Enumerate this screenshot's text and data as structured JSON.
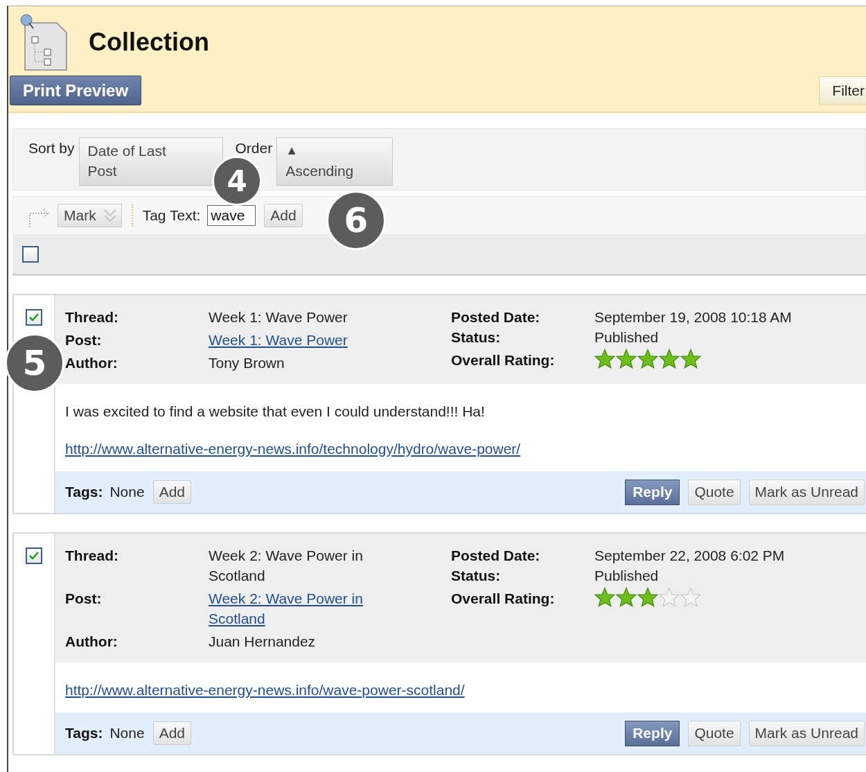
{
  "header": {
    "title": "Collection",
    "print_button": "Print Preview",
    "filter_button": "Filter"
  },
  "sort": {
    "label": "Sort by",
    "value": "Date of Last Post",
    "order_label": "Order",
    "order_arrow": "▲",
    "order_value": "Ascending"
  },
  "actions": {
    "mark": "Mark",
    "tag_label": "Tag Text:",
    "tag_value": "wave",
    "add": "Add"
  },
  "select_all": {
    "checked": false
  },
  "posts": [
    {
      "checked": true,
      "thread_label": "Thread:",
      "thread": "Week 1: Wave Power",
      "post_label": "Post:",
      "post": "Week 1: Wave Power",
      "author_label": "Author:",
      "author": "Tony Brown",
      "date_label": "Posted Date:",
      "date": "September 19, 2008 10:18 AM",
      "status_label": "Status:",
      "status": "Published",
      "rating_label": "Overall Rating:",
      "stars": 5,
      "body": "I was excited to find a website that even I could understand!!! Ha!",
      "link": "http://www.alternative-energy-news.info/technology/hydro/wave-power/",
      "tags_label": "Tags:",
      "tags": "None",
      "add": "Add",
      "reply": "Reply",
      "quote": "Quote",
      "mark_unread": "Mark as Unread"
    },
    {
      "checked": true,
      "thread_label": "Thread:",
      "thread": "Week 2: Wave Power in Scotland",
      "post_label": "Post:",
      "post": "Week 2: Wave Power in Scotland",
      "author_label": "Author:",
      "author": "Juan Hernandez",
      "date_label": "Posted Date:",
      "date": "September 22, 2008 6:02 PM",
      "status_label": "Status:",
      "status": "Published",
      "rating_label": "Overall Rating:",
      "stars": 3,
      "link": "http://www.alternative-energy-news.info/wave-power-scotland/",
      "tags_label": "Tags:",
      "tags": "None",
      "add": "Add",
      "reply": "Reply",
      "quote": "Quote",
      "mark_unread": "Mark as Unread"
    }
  ],
  "callouts": [
    {
      "label": "4"
    },
    {
      "label": "6"
    },
    {
      "label": "5"
    }
  ]
}
